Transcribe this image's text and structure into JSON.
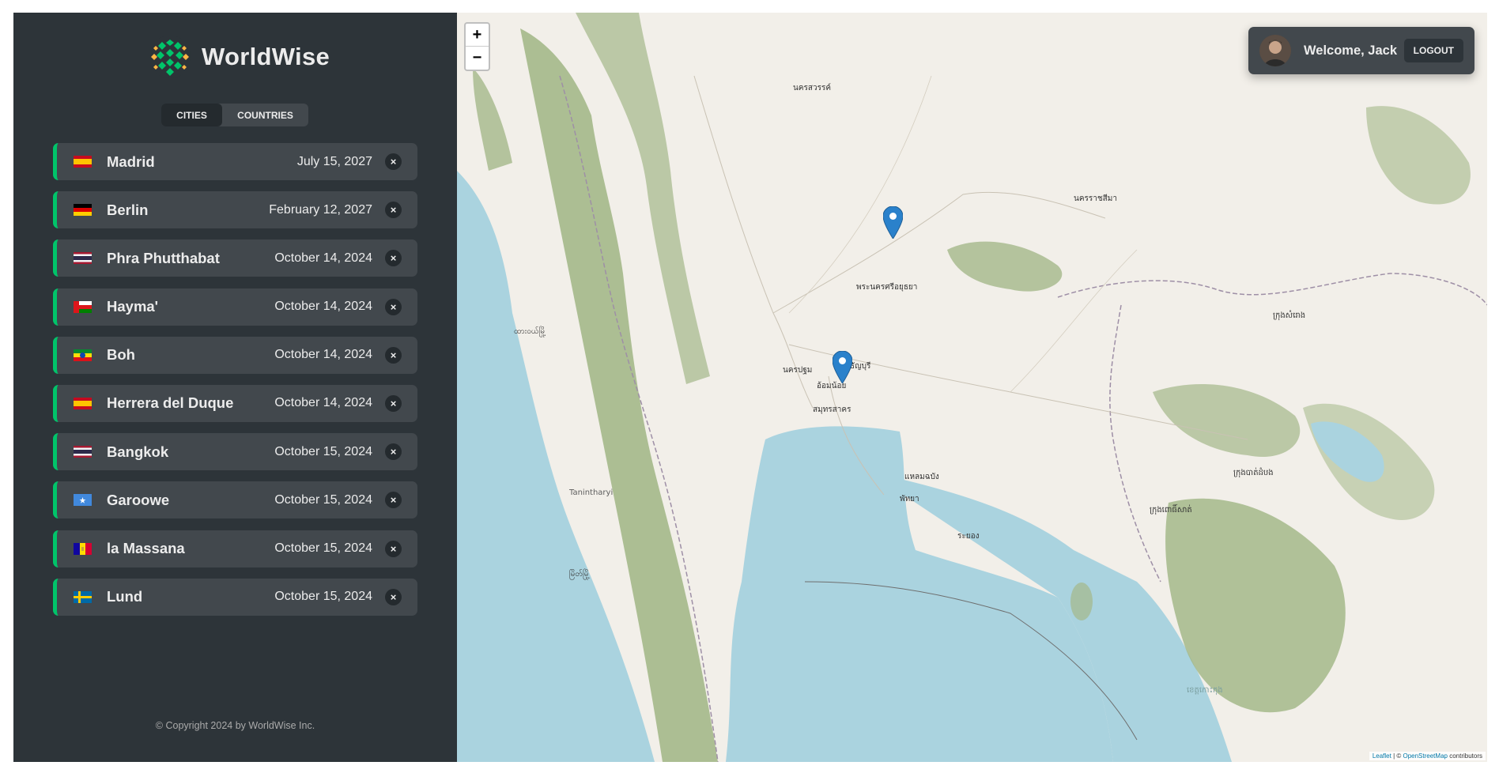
{
  "app": {
    "name": "WorldWise"
  },
  "tabs": {
    "cities": "CITIES",
    "countries": "COUNTRIES"
  },
  "cities": [
    {
      "name": "Madrid",
      "date": "July 15, 2027",
      "flag": "es"
    },
    {
      "name": "Berlin",
      "date": "February 12, 2027",
      "flag": "de"
    },
    {
      "name": "Phra Phutthabat",
      "date": "October 14, 2024",
      "flag": "th"
    },
    {
      "name": "Hayma'",
      "date": "October 14, 2024",
      "flag": "om"
    },
    {
      "name": "Boh",
      "date": "October 14, 2024",
      "flag": "et"
    },
    {
      "name": "Herrera del Duque",
      "date": "October 14, 2024",
      "flag": "es"
    },
    {
      "name": "Bangkok",
      "date": "October 15, 2024",
      "flag": "th"
    },
    {
      "name": "Garoowe",
      "date": "October 15, 2024",
      "flag": "so"
    },
    {
      "name": "la Massana",
      "date": "October 15, 2024",
      "flag": "ad"
    },
    {
      "name": "Lund",
      "date": "October 15, 2024",
      "flag": "se"
    }
  ],
  "delete_symbol": "×",
  "footer": {
    "copyright": "© Copyright 2024 by WorldWise Inc."
  },
  "user": {
    "welcome": "Welcome, Jack",
    "logout": "LOGOUT"
  },
  "map": {
    "zoom_in": "+",
    "zoom_out": "−",
    "attribution": {
      "leaflet": "Leaflet",
      "sep": " | © ",
      "osm": "OpenStreetMap",
      "contrib": " contributors"
    },
    "labels": [
      "นครสวรรค์",
      "นครราชสีมา",
      "พระนครศรีอยุธยา",
      "ธัญบุรี",
      "นครปฐม",
      "อ้อมน้อย",
      "สมุทรสาคร",
      "แหลมฉบัง",
      "พัทยา",
      "ระยอง",
      "Tanintharyi",
      "ထားဝယ်မြို့",
      "မြိတ်မြို့",
      "ក្រុងសំរោង",
      "ក្រុងបាត់ដំបង",
      "ក្រុងពោធិ៍សាត់",
      "ខេត្តកោះកុង"
    ]
  },
  "colors": {
    "accent": "#00c46a",
    "sidebar": "#2d3439",
    "card": "#42484d",
    "water": "#aad3df",
    "forest": "#a4b889"
  }
}
